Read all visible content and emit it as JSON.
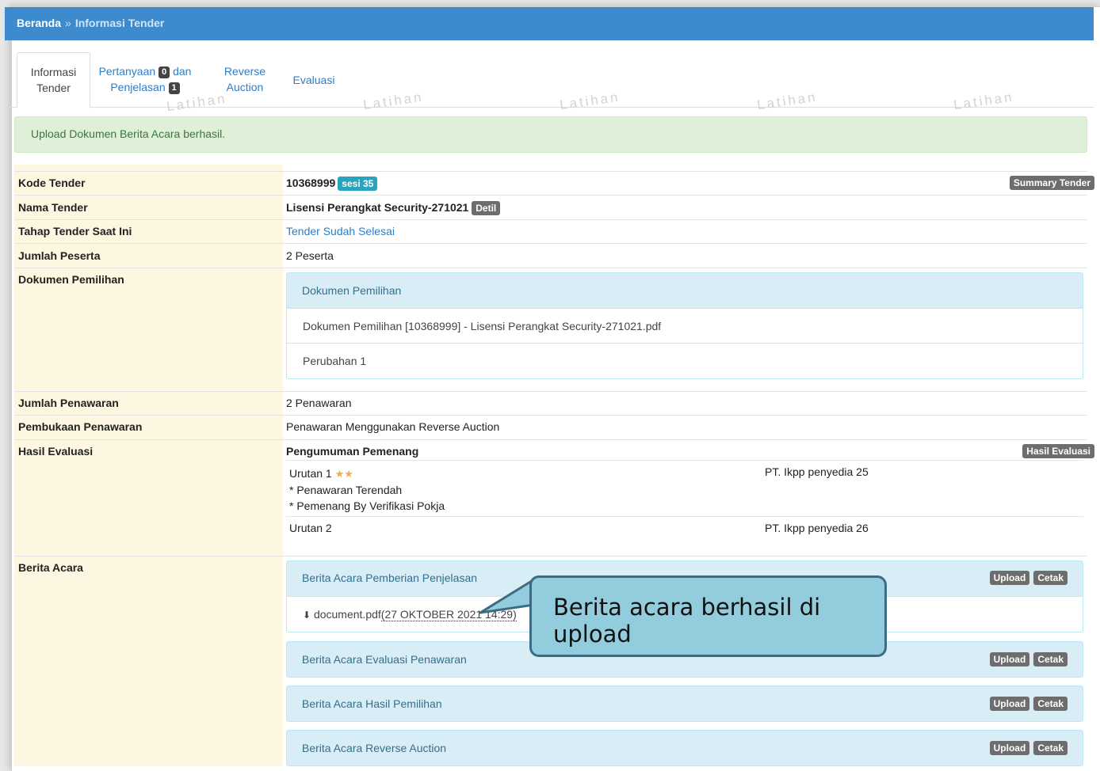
{
  "breadcrumb": {
    "home": "Beranda",
    "separator": "»",
    "current": "Informasi Tender"
  },
  "tabs": {
    "info_line1": "Informasi",
    "info_line2": "Tender",
    "tanya_line1": "Pertanyaan",
    "tanya_count": "0",
    "tanya_mid": "dan",
    "tanya_line2": "Penjelasan",
    "tanya_count2": "1",
    "reverse_line1": "Reverse",
    "reverse_line2": "Auction",
    "evaluasi": "Evaluasi"
  },
  "watermark": "Latihan",
  "alert": "Upload Dokumen Berita Acara berhasil.",
  "rows": {
    "kode": {
      "label": "Kode Tender",
      "value": "10368999",
      "badge": "sesi 35",
      "action": "Summary Tender"
    },
    "nama": {
      "label": "Nama Tender",
      "value": "Lisensi Perangkat Security-271021",
      "badge": "Detil"
    },
    "tahap": {
      "label": "Tahap Tender Saat Ini",
      "value": "Tender Sudah Selesai"
    },
    "jumlah_peserta": {
      "label": "Jumlah Peserta",
      "value": "2 Peserta"
    },
    "dokumen": {
      "label": "Dokumen Pemilihan",
      "panel_title": "Dokumen Pemilihan",
      "file": "Dokumen Pemilihan [10368999] - Lisensi Perangkat Security-271021.pdf",
      "perubahan": "Perubahan 1"
    },
    "jumlah_penawaran": {
      "label": "Jumlah Penawaran",
      "value": "2 Penawaran"
    },
    "pembukaan": {
      "label": "Pembukaan Penawaran",
      "value": "Penawaran Menggunakan Reverse Auction"
    },
    "hasil": {
      "label": "Hasil Evaluasi",
      "heading": "Pengumuman Pemenang",
      "action": "Hasil Evaluasi",
      "u1": "Urutan 1",
      "u1_note1": "* Penawaran Terendah",
      "u1_note2": "* Pemenang By Verifikasi Pokja",
      "u1_company": "PT. Ikpp penyedia 25",
      "u2": "Urutan 2",
      "u2_company": "PT. Ikpp penyedia 26"
    },
    "berita": {
      "label": "Berita Acara",
      "upload": "Upload",
      "cetak": "Cetak",
      "p1": "Berita Acara Pemberian Penjelasan",
      "p1_file": "document.pdf",
      "p1_date": "(27 OKTOBER 2021 14:29)",
      "p2": "Berita Acara Evaluasi Penawaran",
      "p3": "Berita Acara Hasil Pemilihan",
      "p4": "Berita Acara Reverse Auction"
    }
  },
  "callout": "Berita acara berhasil di upload"
}
